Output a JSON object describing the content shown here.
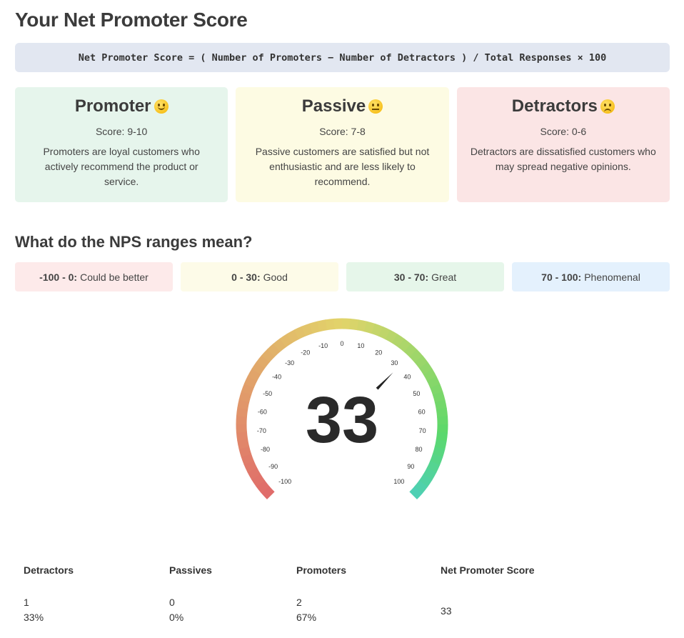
{
  "page": {
    "title": "Your Net Promoter Score"
  },
  "formula": "Net Promoter Score = ( Number of Promoters − Number of Detractors ) / Total Responses × 100",
  "cards": [
    {
      "title": "Promoter",
      "emoji": "smiling-face-icon",
      "score": "Score: 9-10",
      "description": "Promoters are loyal customers who actively recommend the product or service.",
      "bg": "#e6f5ec"
    },
    {
      "title": "Passive",
      "emoji": "neutral-face-icon",
      "score": "Score: 7-8",
      "description": "Passive customers are satisfied but not enthusiastic and are less likely to recommend.",
      "bg": "#fdfbe3"
    },
    {
      "title": "Detractors",
      "emoji": "disappointed-face-icon",
      "score": "Score: 0-6",
      "description": "Detractors are dissatisfied customers who may spread negative opinions.",
      "bg": "#fbe5e5"
    }
  ],
  "ranges_title": "What do the NPS ranges mean?",
  "ranges": [
    {
      "range": "-100 - 0:",
      "label": "Could be better",
      "bg": "#fdeaea"
    },
    {
      "range": "0 - 30:",
      "label": "Good",
      "bg": "#fdfbe8"
    },
    {
      "range": "30 - 70:",
      "label": "Great",
      "bg": "#e6f6ea"
    },
    {
      "range": "70 - 100:",
      "label": "Phenomenal",
      "bg": "#e4f1fd"
    }
  ],
  "gauge": {
    "value": "33",
    "score": 33,
    "min": -100,
    "max": 100,
    "ticks": [
      "-100",
      "-90",
      "-80",
      "-70",
      "-60",
      "-50",
      "-40",
      "-30",
      "-20",
      "-10",
      "0",
      "10",
      "20",
      "30",
      "40",
      "50",
      "60",
      "70",
      "80",
      "90",
      "100"
    ],
    "colors": {
      "low": "#e06a6a",
      "mid": "#e2d46a",
      "high": "#5cd86a",
      "end": "#4dd0b8"
    }
  },
  "summary": {
    "headers": {
      "detractors": "Detractors",
      "passives": "Passives",
      "promoters": "Promoters",
      "nps": "Net Promoter Score"
    },
    "detractors": {
      "count": "1",
      "pct": "33%"
    },
    "passives": {
      "count": "0",
      "pct": "0%"
    },
    "promoters": {
      "count": "2",
      "pct": "67%"
    },
    "nps": "33"
  }
}
